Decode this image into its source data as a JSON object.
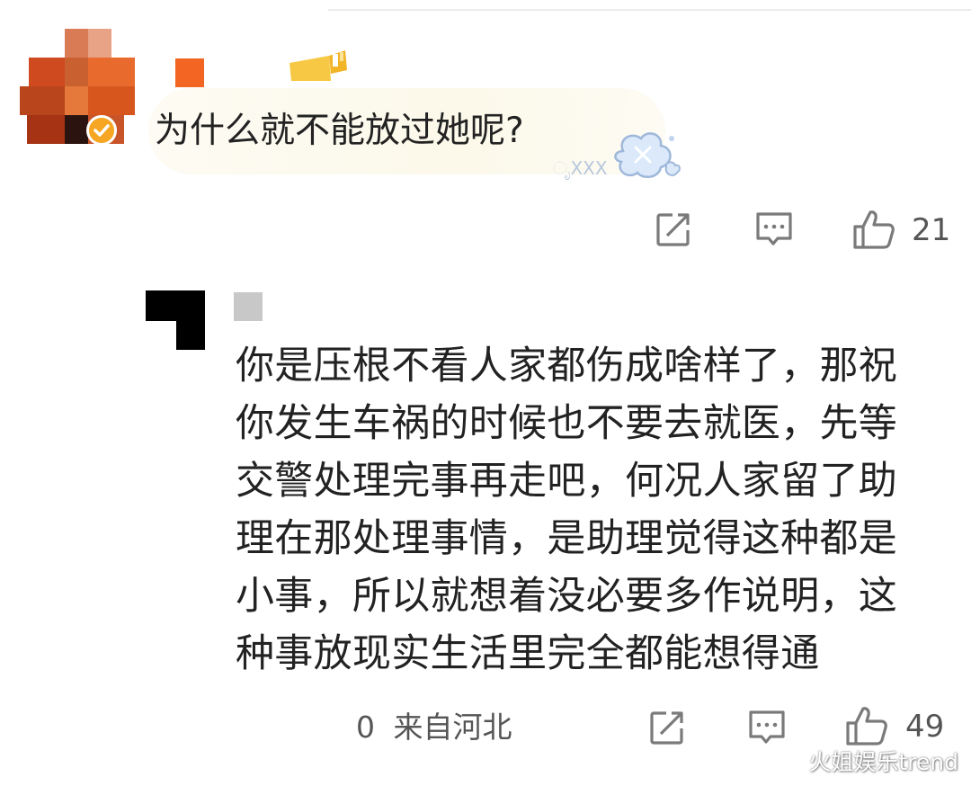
{
  "comments": [
    {
      "avatar_icon": "pixelated-avatar-icon",
      "verified_badge_icon": "verified-badge-icon",
      "level_badge_icon": "user-level-badge-icon",
      "text": "为什么就不能放过她呢?",
      "bubble_sticker_icon": "cloud-sticker-icon",
      "bubble_sticker_text": "ೃXXX",
      "actions": {
        "share_icon": "share-icon",
        "comment_icon": "comment-icon",
        "like_icon": "thumbs-up-icon",
        "like_count": "21"
      }
    }
  ],
  "reply": {
    "avatar_icon": "pixelated-avatar-icon",
    "text": "你是压根不看人家都伤成啥样了，那祝你发生车祸的时候也不要去就医，先等交警处理完事再走吧，何况人家留了助理在那处理事情，是助理觉得这种都是小事，所以就想着没必要多作说明，这种事放现实生活里完全都能想得通",
    "reply_count": "0",
    "location": "来自河北",
    "actions": {
      "share_icon": "share-icon",
      "comment_icon": "comment-icon",
      "like_icon": "thumbs-up-icon",
      "like_count": "49"
    }
  },
  "watermark": "火姐娱乐trend",
  "colors": {
    "text_primary": "#222222",
    "text_secondary": "#555555",
    "icon_gray": "#7a7a7a",
    "bubble_bg": "#fcf9ea",
    "username_orange": "#f26522",
    "badge_gold": "#f6a623"
  }
}
